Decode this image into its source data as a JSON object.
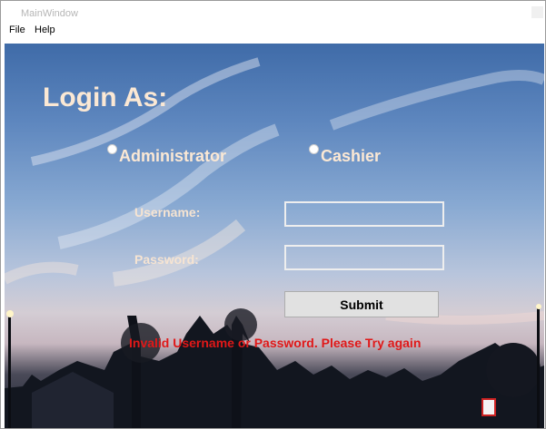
{
  "window": {
    "title": "MainWindow"
  },
  "menu": [
    "File",
    "Help"
  ],
  "login": {
    "heading": "Login As:",
    "roles": [
      "Administrator",
      "Cashier"
    ],
    "username_label": "Username:",
    "password_label": "Password:",
    "username_value": "",
    "password_value": "",
    "submit_label": "Submit",
    "error_message": "Invalid Username or Password. Please Try again"
  },
  "colors": {
    "heading_text": "#fbe8d4",
    "error_text": "#e01818",
    "button_bg": "#e1e1e1",
    "sky_top": "#3f6ba8"
  }
}
